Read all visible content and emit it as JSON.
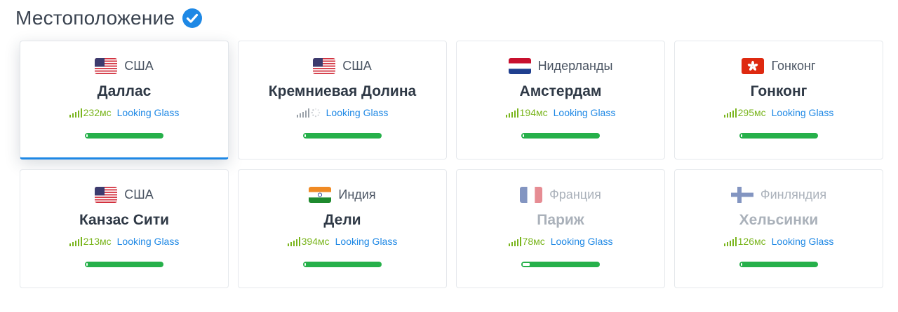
{
  "header": {
    "title": "Местоположение"
  },
  "ping_unit": "мс",
  "link_label": "Looking Glass",
  "cards": [
    {
      "country": "США",
      "city": "Даллас",
      "flag": "us",
      "ping": "232мс",
      "active": true,
      "dim": false,
      "loading": false,
      "level": 0.97
    },
    {
      "country": "США",
      "city": "Кремниевая Долина",
      "flag": "us",
      "ping": "",
      "active": false,
      "dim": false,
      "loading": true,
      "level": 0.97
    },
    {
      "country": "Нидерланды",
      "city": "Амстердам",
      "flag": "nl",
      "ping": "194мс",
      "active": false,
      "dim": false,
      "loading": false,
      "level": 0.97
    },
    {
      "country": "Гонконг",
      "city": "Гонконг",
      "flag": "hk",
      "ping": "295мс",
      "active": false,
      "dim": false,
      "loading": false,
      "level": 0.97
    },
    {
      "country": "США",
      "city": "Канзас Сити",
      "flag": "us",
      "ping": "213мс",
      "active": false,
      "dim": false,
      "loading": false,
      "level": 0.97
    },
    {
      "country": "Индия",
      "city": "Дели",
      "flag": "in",
      "ping": "394мс",
      "active": false,
      "dim": false,
      "loading": false,
      "level": 0.97
    },
    {
      "country": "Франция",
      "city": "Париж",
      "flag": "fr",
      "ping": "78мс",
      "active": false,
      "dim": true,
      "loading": false,
      "level": 0.9
    },
    {
      "country": "Финляндия",
      "city": "Хельсинки",
      "flag": "fi",
      "ping": "126мс",
      "active": false,
      "dim": true,
      "loading": false,
      "level": 0.97
    }
  ],
  "colors": {
    "accent": "#1e88e5",
    "bar": "#26b04a",
    "ping": "#7ab51d"
  }
}
